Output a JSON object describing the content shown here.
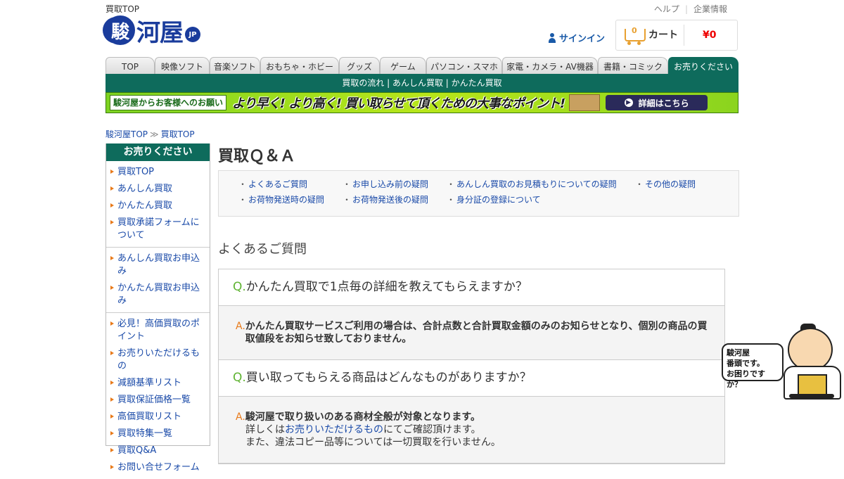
{
  "header": {
    "top_label": "買取TOP",
    "logo_mark": "駿",
    "logo_text": "河屋",
    "logo_jp": "JP",
    "links": [
      "ヘルプ",
      "企業情報"
    ],
    "signin": "サインイン",
    "cart": {
      "count": "0",
      "label": "カート",
      "price": "¥0"
    }
  },
  "tabs": [
    "TOP",
    "映像ソフト",
    "音楽ソフト",
    "おもちゃ・ホビー",
    "グッズ",
    "ゲーム",
    "パソコン・スマホ",
    "家電・カメラ・AV機器",
    "書籍・コミック",
    "お売りください"
  ],
  "subnav": "買取の流れ | あんしん買取 | かんたん買取",
  "banner": {
    "left": "駿河屋からお客様へのお願い",
    "main": "より早く! より高く! 買い取らせて頂くための大事なポイント!",
    "button": "詳細はこちら"
  },
  "breadcrumb": [
    "駿河屋TOP",
    "買取TOP"
  ],
  "breadcrumb_sep": "≫",
  "sidebar": {
    "title": "お売りください",
    "groups": [
      [
        "買取TOP",
        "あんしん買取",
        "かんたん買取",
        "買取承諾フォームについて"
      ],
      [
        "あんしん買取お申込み",
        "かんたん買取お申込み"
      ],
      [
        "必見！高価買取のポイント",
        "お売りいただけるもの",
        "減額基準リスト",
        "買取保証価格一覧",
        "高価買取リスト",
        "買取特集一覧",
        "買取Q&A",
        "お問い合せフォーム"
      ]
    ]
  },
  "main": {
    "title": "買取Ｑ＆Ａ",
    "qa_nav": [
      "よくあるご質問",
      "お申し込み前の疑問",
      "あんしん買取のお見積もりについての疑問",
      "その他の疑問",
      "お荷物発送時の疑問",
      "お荷物発送後の疑問",
      "身分証の登録について"
    ],
    "section_title": "よくあるご質問",
    "faq": [
      {
        "q_mark": "Q.",
        "q": "かんたん買取で1点毎の詳細を教えてもらえますか？",
        "a_mark": "A.",
        "a": "かんたん買取サービスご利用の場合は、合計点数と合計買取金額のみのお知らせとなり、個別の商品の買取値段をお知らせ致しておりません。"
      },
      {
        "q_mark": "Q.",
        "q": "買い取ってもらえる商品はどんなものがありますか？",
        "a_mark": "A.",
        "a": "駿河屋で取り扱いのある商材全般が対象となります。",
        "a2_pre": "詳しくは",
        "a2_link": "お売りいただけるもの",
        "a2_post": "にてご確認頂けます。",
        "a3": "また、違法コピー品等については一切買取を行いません。"
      }
    ]
  },
  "mascot": {
    "line1": "駿河屋",
    "line2": "番頭です。",
    "line3": "お困りですか？"
  }
}
